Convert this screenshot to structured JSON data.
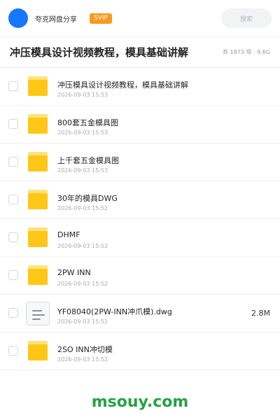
{
  "header": {
    "brand": "夸克网盘分享",
    "badge": "SVIP",
    "search_placeholder": "搜索",
    "accent_color": "#1677ff",
    "badge_color": "#f79a1f"
  },
  "folder": {
    "title": "冲压模具设计视频教程，模具基础讲解",
    "stats": "共 1873 项 · 9.6G"
  },
  "files": [
    {
      "type": "folder",
      "icon": "folder-icon",
      "name": "冲压模具设计视频教程，模具基础讲解",
      "date": "2026-09-03 15:53",
      "size": ""
    },
    {
      "type": "folder",
      "icon": "folder-icon",
      "name": "800套五金模具图",
      "date": "2026-09-03 15:53",
      "size": ""
    },
    {
      "type": "folder",
      "icon": "folder-icon",
      "name": "上千套五金模具图",
      "date": "2026-09-03 15:53",
      "size": ""
    },
    {
      "type": "folder",
      "icon": "folder-icon",
      "name": "30年的模具DWG",
      "date": "2026-09-03 15:52",
      "size": ""
    },
    {
      "type": "folder",
      "icon": "folder-icon",
      "name": "DHMF",
      "date": "2026-09-03 15:52",
      "size": ""
    },
    {
      "type": "folder",
      "icon": "folder-icon",
      "name": "2PW INN",
      "date": "2026-09-03 15:52",
      "size": ""
    },
    {
      "type": "file",
      "icon": "document-icon",
      "name": "YF08040(2PW-INN冲爪模).dwg",
      "date": "2026-09-03 15:52",
      "size": "2.8M"
    },
    {
      "type": "folder",
      "icon": "folder-icon",
      "name": "2SO INN冲切模",
      "date": "2026-09-03 15:52",
      "size": ""
    }
  ],
  "watermark": "msouy.com"
}
